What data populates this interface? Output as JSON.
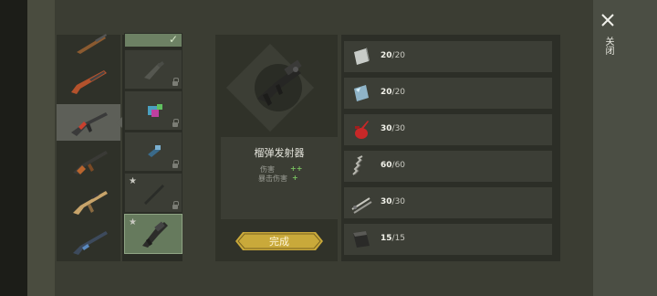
{
  "weapon_list": [
    {
      "icon": "shotgun-icon"
    },
    {
      "icon": "pump-shotgun-icon"
    },
    {
      "icon": "assault-rifle-icon",
      "selected": true
    },
    {
      "icon": "ak-rifle-icon"
    },
    {
      "icon": "tan-rifle-icon"
    },
    {
      "icon": "blue-rifle-icon"
    }
  ],
  "upgrade_slots": [
    {
      "icon": "check-icon",
      "state": "done",
      "mark": "✓"
    },
    {
      "icon": "stock-part-icon",
      "state": "locked"
    },
    {
      "icon": "colored-magazine-icon",
      "state": "locked"
    },
    {
      "icon": "blue-part-icon",
      "state": "locked"
    },
    {
      "icon": "barrel-part-icon",
      "state": "locked",
      "star": "★"
    },
    {
      "icon": "launcher-part-icon",
      "state": "active",
      "star": "★"
    }
  ],
  "center": {
    "weapon_name": "榴弹发射器",
    "stats": [
      {
        "label": "伤害",
        "plus": "++"
      },
      {
        "label": "暴击伤害",
        "plus": "+"
      }
    ],
    "done_label": "完成"
  },
  "materials": [
    {
      "icon": "metal-plate-icon",
      "have": "20",
      "need": "/20"
    },
    {
      "icon": "glass-plate-icon",
      "have": "20",
      "need": "/20"
    },
    {
      "icon": "oil-can-icon",
      "have": "30",
      "need": "/30"
    },
    {
      "icon": "spring-icon",
      "have": "60",
      "need": "/60"
    },
    {
      "icon": "rods-icon",
      "have": "30",
      "need": "/30"
    },
    {
      "icon": "bent-plate-icon",
      "have": "15",
      "need": "/15"
    }
  ],
  "close_label": "关闭",
  "colors": {
    "accent": "#c9a93a",
    "active_slot": "#667a5d",
    "plus": "#78c060"
  }
}
